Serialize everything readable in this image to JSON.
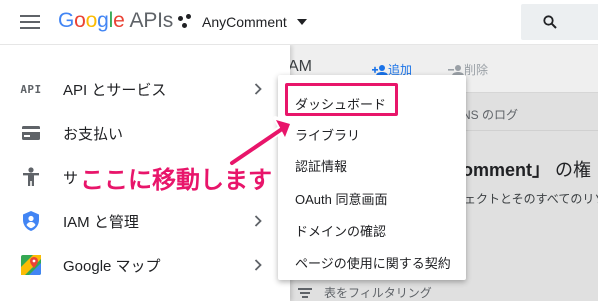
{
  "header": {
    "logo_google": [
      "G",
      "o",
      "o",
      "g",
      "l",
      "e"
    ],
    "logo_apis": "APIs",
    "project_name": "AnyComment"
  },
  "sidebar": {
    "items": [
      {
        "label": "API とサービス",
        "icon": "api-icon"
      },
      {
        "label": "お支払い",
        "icon": "billing-icon"
      },
      {
        "label": "サ",
        "icon": "support-icon"
      },
      {
        "label": "IAM と管理",
        "icon": "shield-icon"
      },
      {
        "label": "Google マップ",
        "icon": "maps-icon"
      }
    ]
  },
  "submenu": {
    "items": [
      "ダッシュボード",
      "ライブラリ",
      "認証情報",
      "OAuth 同意画面",
      "ドメインの確認",
      "ページの使用に関する契約"
    ]
  },
  "annotation": {
    "text": "ここに移動します",
    "color": "#e8156a"
  },
  "background_page": {
    "title": "AM",
    "add_label": "追加",
    "delete_label": "削除",
    "log_label": "NS のログ",
    "heading_name": "omment」",
    "heading_rest": "の権",
    "description": "ェクトとそのすべてのリソ",
    "filter_label": "表をフィルタリング"
  }
}
